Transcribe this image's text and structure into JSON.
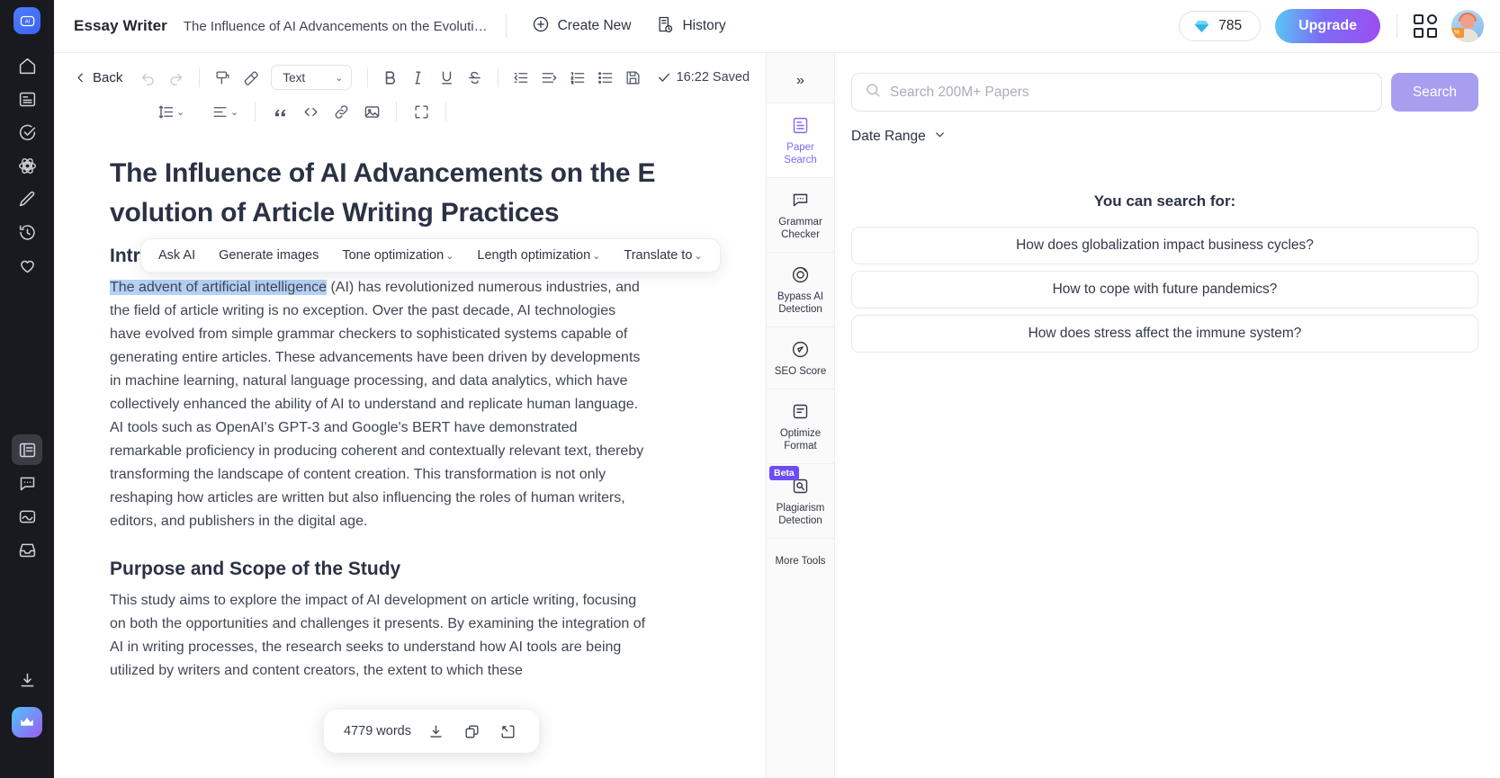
{
  "app": {
    "brand": "Essay Writer",
    "doc_title": "The Influence of AI Advancements on the Evoluti…"
  },
  "topbar": {
    "create_new": "Create New",
    "history": "History",
    "credits": "785",
    "upgrade": "Upgrade"
  },
  "left_rail": {
    "items": [
      {
        "name": "logo",
        "icon": "ai-logo-icon"
      },
      {
        "name": "home",
        "icon": "home-icon"
      },
      {
        "name": "documents",
        "icon": "document-icon"
      },
      {
        "name": "tasks",
        "icon": "check-circle-icon"
      },
      {
        "name": "models",
        "icon": "atom-icon"
      },
      {
        "name": "write",
        "icon": "pencil-icon"
      },
      {
        "name": "history",
        "icon": "clock-history-icon"
      },
      {
        "name": "favorites",
        "icon": "heart-icon"
      },
      {
        "name": "essay",
        "icon": "book-icon"
      },
      {
        "name": "chat",
        "icon": "chat-icon"
      },
      {
        "name": "images",
        "icon": "image-icon"
      },
      {
        "name": "inbox",
        "icon": "inbox-icon"
      },
      {
        "name": "download",
        "icon": "download-icon"
      },
      {
        "name": "premium",
        "icon": "crown-icon"
      }
    ]
  },
  "editor": {
    "back": "Back",
    "style_select": "Text",
    "saved_status": "16:22 Saved",
    "title": "The Influence of AI Advancements on the Evolution of Article Writing Practices",
    "h2_intro": "Introduction",
    "paragraph_intro_selected": "The advent of artificial intelligence",
    "paragraph_intro_rest": " (AI) has revolutionized numerous industries, and the field of article writing is no exception. Over the past decade, AI technologies have evolved from simple grammar checkers to sophisticated systems capable of generating entire articles. These advancements have been driven by developments in machine learning, natural language processing, and data analytics, which have collectively enhanced the ability of AI to understand and replicate human language. AI tools such as OpenAI's GPT-3 and Google's BERT have demonstrated remarkable proficiency in producing coherent and contextually relevant text, thereby transforming the landscape of content creation. This transformation is not only reshaping how articles are written but also influencing the roles of human writers, editors, and publishers in the digital age.",
    "h2_purpose": "Purpose and Scope of the Study",
    "paragraph_purpose": "This study aims to explore the impact of AI development on article writing, focusing on both the opportunities and challenges it presents. By examining the integration of AI in writing processes, the research seeks to understand how AI tools are being utilized by writers and content creators, the extent to which these",
    "word_count": "4779 words",
    "word_actions": [
      "download-icon",
      "copy-icon",
      "open-external-icon"
    ]
  },
  "ai_toolbar": {
    "items": [
      {
        "label": "Ask AI",
        "caret": false
      },
      {
        "label": "Generate images",
        "caret": false
      },
      {
        "label": "Tone optimization",
        "caret": true
      },
      {
        "label": "Length optimization",
        "caret": true
      },
      {
        "label": "Translate to",
        "caret": true
      }
    ],
    "caret_glyph": "⌄"
  },
  "tools_panel": {
    "collapse_glyph": "»",
    "items": [
      {
        "label": "Paper Search",
        "icon": "paper-search-icon",
        "active": true,
        "badge": ""
      },
      {
        "label": "Grammar Checker",
        "icon": "grammar-icon",
        "active": false,
        "badge": ""
      },
      {
        "label": "Bypass AI Detection",
        "icon": "bypass-ai-icon",
        "active": false,
        "badge": ""
      },
      {
        "label": "SEO Score",
        "icon": "seo-score-icon",
        "active": false,
        "badge": ""
      },
      {
        "label": "Optimize Format",
        "icon": "optimize-format-icon",
        "active": false,
        "badge": ""
      },
      {
        "label": "Plagiarism Detection",
        "icon": "plagiarism-icon",
        "active": false,
        "badge": "Beta"
      },
      {
        "label": "More Tools",
        "icon": "",
        "active": false,
        "badge": ""
      }
    ]
  },
  "right_panel": {
    "search_placeholder": "Search 200M+ Papers",
    "search_value": "",
    "search_button": "Search",
    "date_range": "Date Range",
    "suggest_title": "You can search for:",
    "suggestions": [
      "How does globalization impact business cycles?",
      "How to cope with future pandemics?",
      "How does stress affect the immune system?"
    ]
  },
  "colors": {
    "accent_purple": "#7b6cf6",
    "search_button": "#a79ef0",
    "selection": "#b5d0f5",
    "rail_bg": "#191a1f",
    "beta_badge": "#6a4df5"
  }
}
